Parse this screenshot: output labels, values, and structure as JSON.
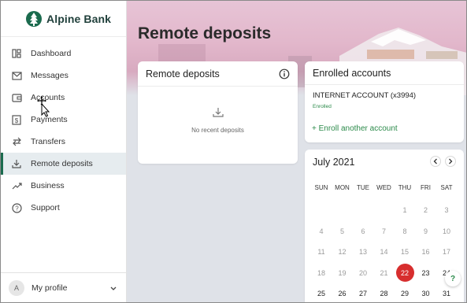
{
  "brand": {
    "name": "Alpine Bank",
    "color": "#1b6b4e"
  },
  "nav": {
    "items": [
      {
        "label": "Dashboard",
        "icon": "dashboard-icon",
        "active": false
      },
      {
        "label": "Messages",
        "icon": "mail-icon",
        "active": false
      },
      {
        "label": "Accounts",
        "icon": "wallet-icon",
        "active": false
      },
      {
        "label": "Payments",
        "icon": "dollar-icon",
        "active": false
      },
      {
        "label": "Transfers",
        "icon": "transfer-arrows-icon",
        "active": false
      },
      {
        "label": "Remote deposits",
        "icon": "download-icon",
        "active": true
      },
      {
        "label": "Business",
        "icon": "trending-up-icon",
        "active": false
      },
      {
        "label": "Support",
        "icon": "help-circle-icon",
        "active": false
      }
    ]
  },
  "profile": {
    "initial": "A",
    "label": "My profile"
  },
  "page": {
    "title": "Remote deposits"
  },
  "remote_deposits": {
    "title": "Remote deposits",
    "empty_text": "No recent deposits"
  },
  "enrolled": {
    "title": "Enrolled accounts",
    "account_name": "INTERNET ACCOUNT (x3994)",
    "status": "Enrolled",
    "add_link": "+ Enroll another account"
  },
  "calendar": {
    "month_label": "July 2021",
    "days_of_week": [
      "SUN",
      "MON",
      "TUE",
      "WED",
      "THU",
      "FRI",
      "SAT"
    ],
    "weeks": [
      [
        "",
        "",
        "",
        "",
        "1",
        "2",
        "3"
      ],
      [
        "4",
        "5",
        "6",
        "7",
        "8",
        "9",
        "10"
      ],
      [
        "11",
        "12",
        "13",
        "14",
        "15",
        "16",
        "17"
      ],
      [
        "18",
        "19",
        "20",
        "21",
        "22",
        "23",
        "24"
      ],
      [
        "25",
        "26",
        "27",
        "28",
        "29",
        "30",
        "31"
      ]
    ],
    "today": "22",
    "today_color": "#d72e2e"
  },
  "help": {
    "label": "?"
  }
}
